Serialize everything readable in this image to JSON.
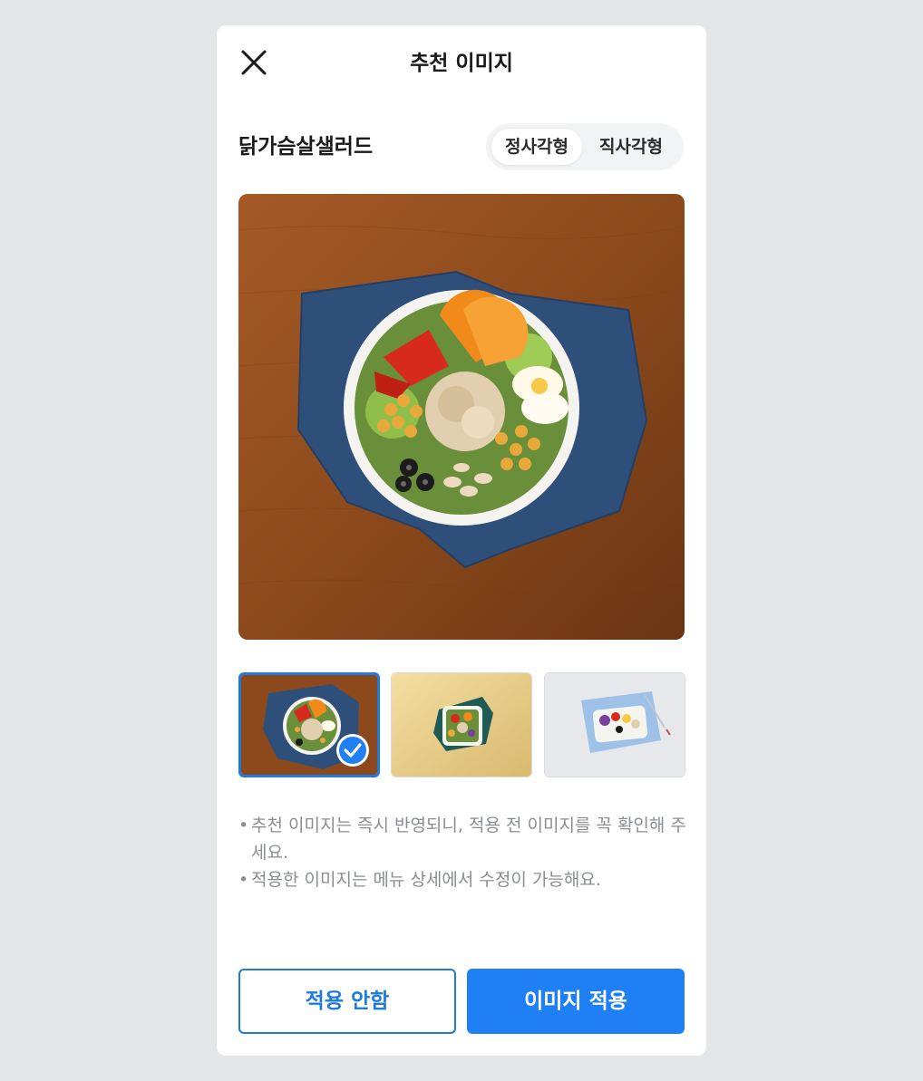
{
  "modal": {
    "title": "추천 이미지",
    "close_icon": "close-icon"
  },
  "menu": {
    "name": "닭가슴살샐러드"
  },
  "aspect_toggle": {
    "options": [
      "정사각형",
      "직사각형"
    ],
    "selected": "정사각형"
  },
  "thumbnails": [
    {
      "name": "wood-table-blue-napkin-salad",
      "selected": true
    },
    {
      "name": "yellow-background-salad-box",
      "selected": false
    },
    {
      "name": "white-background-blue-tray-salad",
      "selected": false
    }
  ],
  "notes": [
    "추천 이미지는 즉시 반영되니, 적용 전 이미지를 꼭 확인해 주세요.",
    "적용한 이미지는 메뉴 상세에서 수정이 가능해요."
  ],
  "bullet": "•",
  "buttons": {
    "cancel": "적용 안함",
    "apply": "이미지 적용"
  },
  "colors": {
    "accent": "#1f7ff5",
    "background": "#e5e6e8",
    "note_text": "#8a8d93"
  }
}
